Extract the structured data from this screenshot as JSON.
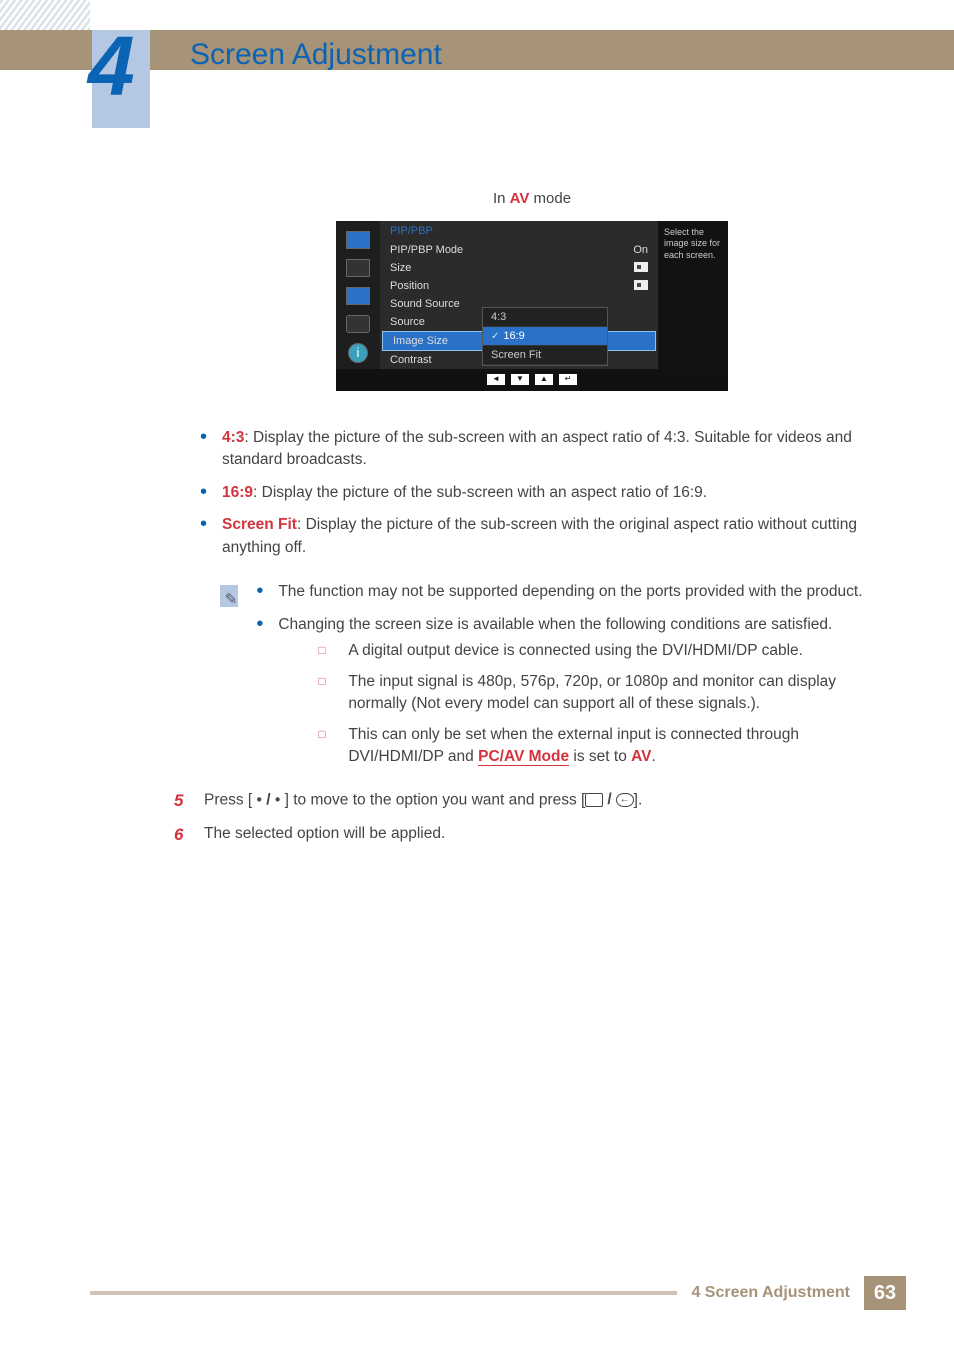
{
  "chapter": {
    "number": "4",
    "title": "Screen Adjustment"
  },
  "mode_label": {
    "prefix": "In ",
    "av": "AV",
    "suffix": " mode"
  },
  "osd": {
    "title": "PIP/PBP",
    "items": [
      {
        "label": "PIP/PBP Mode",
        "value": "On"
      },
      {
        "label": "Size",
        "value": ""
      },
      {
        "label": "Position",
        "value": ""
      },
      {
        "label": "Sound Source",
        "value": ""
      },
      {
        "label": "Source",
        "value": ""
      },
      {
        "label": "Image Size",
        "value": ""
      },
      {
        "label": "Contrast",
        "value": ""
      }
    ],
    "popup": [
      "4:3",
      "16:9",
      "Screen Fit"
    ],
    "help": "Select the image size for each screen.",
    "nav_icons": [
      "left",
      "down",
      "up",
      "enter"
    ]
  },
  "bullets": [
    {
      "term": "4:3",
      "text": ": Display the picture of the sub-screen with an aspect ratio of 4:3. Suitable for videos and standard broadcasts."
    },
    {
      "term": "16:9",
      "text": ": Display the picture of the sub-screen with an aspect ratio of 16:9."
    },
    {
      "term": "Screen Fit",
      "text": ": Display the picture of the sub-screen with the original aspect ratio without cutting anything off."
    }
  ],
  "notes": {
    "top": [
      "The function may not be supported depending on the ports provided with the product.",
      "Changing the screen size is available when the following conditions are satisfied."
    ],
    "sub": [
      "A digital output device is connected using the DVI/HDMI/DP cable.",
      "The input signal is 480p, 576p, 720p, or 1080p and monitor can display normally (Not every model can support all of these signals.).",
      {
        "pre": "This can only be set when the external input is connected through DVI/HDMI/DP and ",
        "pcav": "PC/AV Mode",
        "mid": " is set to ",
        "av": "AV",
        "post": "."
      }
    ]
  },
  "steps": [
    {
      "num": "5",
      "pre": "Press [ • ",
      "slash": "/",
      "mid": " • ] to move to the option you want and press [",
      "post": "]."
    },
    {
      "num": "6",
      "text": "The selected option will be applied."
    }
  ],
  "footer": {
    "label": "4 Screen Adjustment",
    "page": "63"
  }
}
